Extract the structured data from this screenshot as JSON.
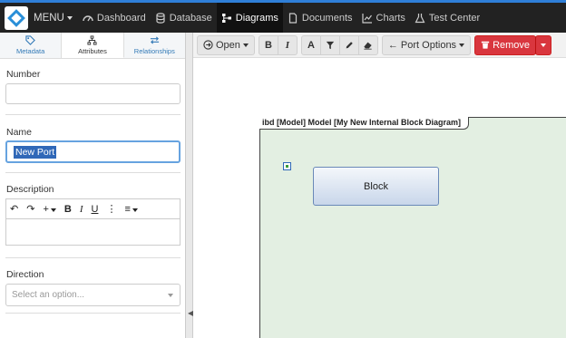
{
  "nav": {
    "menu_label": "MENU",
    "items": [
      {
        "label": "Dashboard",
        "icon": "dashboard-icon"
      },
      {
        "label": "Database",
        "icon": "database-icon"
      },
      {
        "label": "Diagrams",
        "icon": "diagrams-icon",
        "active": true
      },
      {
        "label": "Documents",
        "icon": "documents-icon"
      },
      {
        "label": "Charts",
        "icon": "charts-icon"
      },
      {
        "label": "Test Center",
        "icon": "flask-icon"
      }
    ]
  },
  "panel": {
    "tabs": [
      {
        "label": "Metadata",
        "icon": "tag-icon"
      },
      {
        "label": "Attributes",
        "icon": "sitemap-icon",
        "active": true
      },
      {
        "label": "Relationships",
        "icon": "exchange-icon"
      }
    ],
    "number_label": "Number",
    "number_value": "",
    "name_label": "Name",
    "name_value": "New Port",
    "description_label": "Description",
    "direction_label": "Direction",
    "direction_placeholder": "Select an option..."
  },
  "toolbar": {
    "open_label": "Open",
    "port_options_label": "Port Options",
    "remove_label": "Remove"
  },
  "diagram": {
    "frame_title": "ibd [Model] Model [My New Internal Block Diagram]",
    "block_label": "Block"
  },
  "colors": {
    "nav_bg": "#222222",
    "accent": "#2f7fd8",
    "remove_button": "#d9363e",
    "frame_fill": "#e3efe2"
  }
}
